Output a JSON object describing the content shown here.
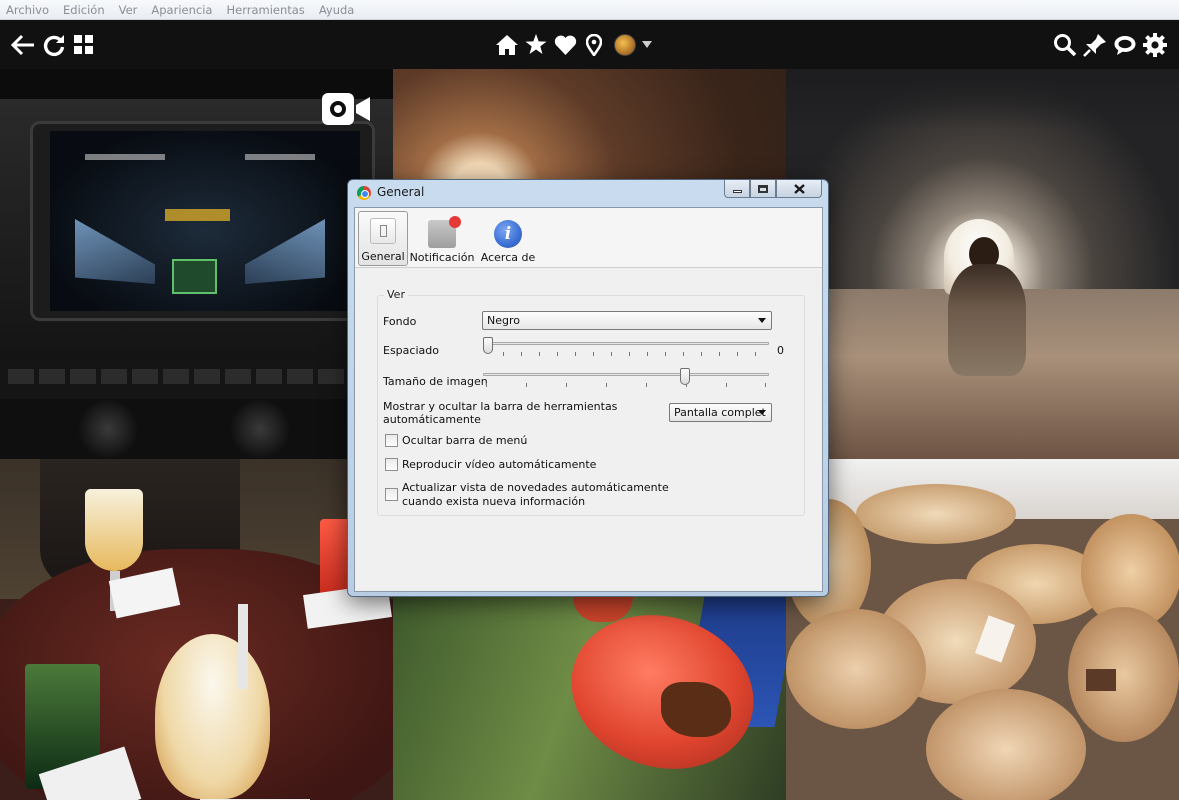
{
  "menubar": {
    "items": [
      "Archivo",
      "Edición",
      "Ver",
      "Apariencia",
      "Herramientas",
      "Ayuda"
    ]
  },
  "toolbar": {
    "left_icons": [
      "back-arrow-icon",
      "refresh-icon",
      "grid-view-icon"
    ],
    "center_icons": [
      "home-icon",
      "star-icon",
      "heart-icon",
      "location-pin-icon",
      "profile-avatar",
      "chevron-down-icon"
    ],
    "right_icons": [
      "search-icon",
      "pin-icon",
      "chat-icon",
      "gear-icon"
    ]
  },
  "dialog": {
    "title": "General",
    "tabs": [
      {
        "label": "General",
        "icon": "general-switch-icon",
        "active": true
      },
      {
        "label": "Notificación",
        "icon": "notification-icon",
        "active": false
      },
      {
        "label": "Acerca de",
        "icon": "info-icon",
        "active": false
      }
    ],
    "group_title": "Ver",
    "fondo": {
      "label": "Fondo",
      "value": "Negro"
    },
    "espaciado": {
      "label": "Espaciado",
      "value": "0",
      "level": 0
    },
    "tamano": {
      "label": "Tamaño de imagen",
      "level": 0.72
    },
    "toolbar_toggle": {
      "label_line1": "Mostrar y ocultar la barra de herramientas",
      "label_line2": "automáticamente",
      "value": "Pantalla complet"
    },
    "checkboxes": [
      {
        "label": "Ocultar barra de menú",
        "checked": false
      },
      {
        "label": "Reproducir vídeo automáticamente",
        "checked": false
      },
      {
        "label_line1": "Actualizar vista de novedades automáticamente",
        "label_line2": "cuando exista nueva información",
        "checked": false
      }
    ]
  },
  "colors": {
    "toolbar_bg": "#111111",
    "menubar_text": "#8a8f96",
    "dialog_frame": "#b8cde4",
    "info_blue": "#3b6fd4",
    "notif_red": "#e53935"
  }
}
